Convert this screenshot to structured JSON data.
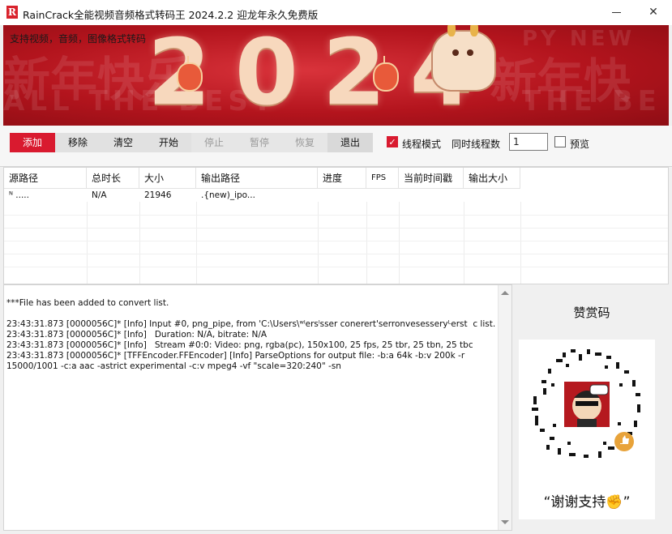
{
  "window": {
    "icon_letter": "R",
    "title": "RainCrack全能视频音频格式转码王 2024.2.2 迎龙年永久免费版",
    "minimize_icon": "minimize-icon",
    "close_icon": "close-icon",
    "close_glyph": "✕"
  },
  "banner": {
    "caption": "支持视频，音频，图像格式转码",
    "year": "2024",
    "decor_colors": {
      "background": "#b3141d",
      "accent": "#f7d8bd"
    }
  },
  "toolbar": {
    "add": "添加",
    "remove": "移除",
    "clear": "清空",
    "start": "开始",
    "stop": "停止",
    "pause": "暂停",
    "resume": "恢复",
    "exit": "退出",
    "thread_mode_label": "线程模式",
    "thread_mode_checked": true,
    "concurrent_label": "同时线程数",
    "concurrent_value": "1",
    "preview_label": "预览",
    "preview_checked": false,
    "check_glyph": "✓"
  },
  "table": {
    "columns": [
      "源路径",
      "总时长",
      "大小",
      "输出路径",
      "进度",
      "FPS",
      "当前时间戳",
      "输出大小"
    ],
    "rows": [
      {
        "source": "  ᴺ         .....",
        "duration": "N/A",
        "size": "21946",
        "output": "                      .{new)_ipo...",
        "progress": "",
        "fps": "",
        "timestamp": "",
        "output_size": ""
      }
    ]
  },
  "log": {
    "text": "***File has been added to convert list.\n\n23:43:31.873 [0000056C]* [Info] Input #0, png_pipe, from 'C:\\Users\\ʷˡersˡsser conerert'serronvesesseryᴸerst  c list.\n23:43:31.873 [0000056C]* [Info]   Duration: N/A, bitrate: N/A\n23:43:31.873 [0000056C]* [Info]   Stream #0:0: Video: png, rgba(pc), 150x100, 25 fps, 25 tbr, 25 tbn, 25 tbc\n23:43:31.873 [0000056C]* [TFFEncoder.FFEncoder] [Info] ParseOptions for output file: -b:a 64k -b:v 200k -r 15000/1001 -c:a aac -astrict experimental -c:v mpeg4 -vf \"scale=320:240\" -sn"
  },
  "donate": {
    "title": "赞赏码",
    "thanks": "“谢谢支持✊”",
    "qr_icon": "wechat-reward-qr-icon",
    "thumb_icon": "thumbs-up-icon",
    "accent": "#e8a33a"
  }
}
